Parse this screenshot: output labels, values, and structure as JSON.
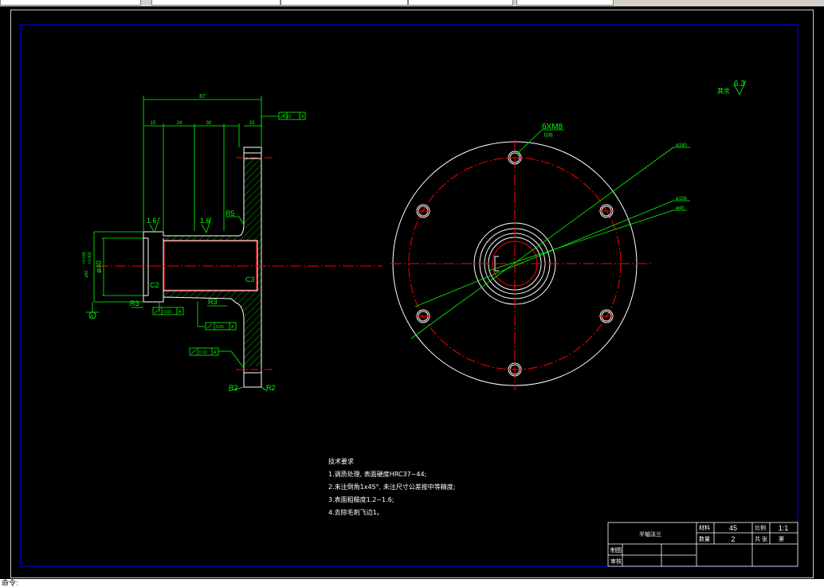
{
  "app": {
    "status_text": "命令:",
    "colors": {
      "background": "#000000",
      "outline": "#ffffff",
      "dimension": "#00ff00",
      "centerline": "#ff0000",
      "border": "#0000ff"
    }
  },
  "drawing": {
    "dims": {
      "total_length": "87",
      "seg1": "15",
      "seg2": "24",
      "seg3": "30",
      "flange_thk": "15",
      "bore_dia": "ø40",
      "tol_upper": "+0.018",
      "tol_lower": "+0.002",
      "tol_base": "ø50",
      "hole_callout": "6XM8",
      "hole_sub": "均布",
      "dia_outer": "ø180",
      "dia_mid": "ø156",
      "dia_small": "ø40"
    },
    "roughness": {
      "general_prefix": "其余",
      "general_value": "6.3",
      "r1": "1.6",
      "r2": "1.6"
    },
    "tolerances": {
      "top_frame_value": "0.10",
      "top_frame_datum": "A",
      "runout1_value": "0.03",
      "runout1_datum": "A",
      "runout2_value": "0.05",
      "runout2_datum": "A",
      "flange_value": "0.10",
      "flange_datum": "A"
    },
    "labels": {
      "chamfer_c2": "C2",
      "chamfer_c3": "C3",
      "radius_r5": "R5",
      "radius_r3": "R3",
      "radius_r3b": "R3",
      "radius_r2a": "R2",
      "radius_r2b": "R2",
      "datum": "A"
    }
  },
  "tech_requirements": {
    "title": "技术要求",
    "items": [
      "1.调质处理, 表面硬度HRC37~44;",
      "2.未注倒角1x45°, 未注尺寸公差按中等精度;",
      "3.表面粗糙度1.2~1.6;",
      "4.去除毛刺飞边1。"
    ]
  },
  "title_block": {
    "part_name": "半轴法兰",
    "material_label": "材料",
    "material_value": "45",
    "scale_label": "比例",
    "scale_value": "1:1",
    "qty_label": "数量",
    "qty_value": "2",
    "sheet_label": "共",
    "sheet_label2": "张",
    "sheet_label3": "第",
    "drawn_label": "制图",
    "checked_label": "审核"
  }
}
